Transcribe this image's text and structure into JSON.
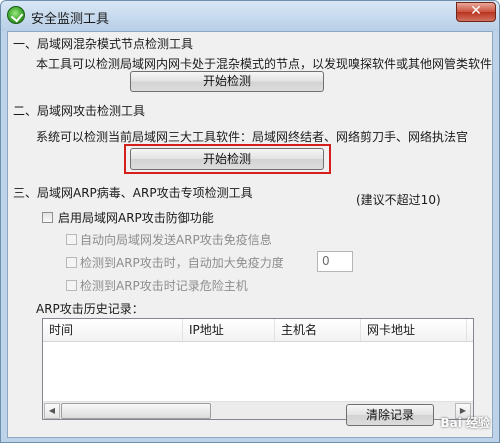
{
  "window": {
    "title": "安全监测工具",
    "close_glyph": "✕"
  },
  "section1": {
    "heading": "一、局域网混杂模式节点检测工具",
    "description": "本工具可以检测局域网内网卡处于混杂模式的节点，以发现嗅探软件或其他网管类软件",
    "button_label": "开始检测"
  },
  "section2": {
    "heading": "二、局域网攻击检测工具",
    "description": "系统可以检测当前局域网三大工具软件：局域网终结者、网络剪刀手、网络执法官",
    "button_label": "开始检测",
    "highlight_color": "#d3201b"
  },
  "section3": {
    "heading": "三、局域网ARP病毒、ARP攻击专项检测工具",
    "hint": "(建议不超过10)",
    "enable_label": "启用局域网ARP攻击防御功能",
    "enable_checked": false,
    "option1_label": "自动向局域网发送ARP攻击免疫信息",
    "option2_label": "检测到ARP攻击时，自动加大免疫力度",
    "option2_value": "0",
    "option3_label": "检测到ARP攻击时记录危险主机",
    "history_label": "ARP攻击历史记录：",
    "columns": [
      "时间",
      "IP地址",
      "主机名",
      "网卡地址",
      "("
    ],
    "rows": [],
    "scroll_left_glyph": "◀",
    "scroll_right_glyph": "▶"
  },
  "footer": {
    "button_label": "清除记录",
    "watermark": "Bai 经验"
  }
}
